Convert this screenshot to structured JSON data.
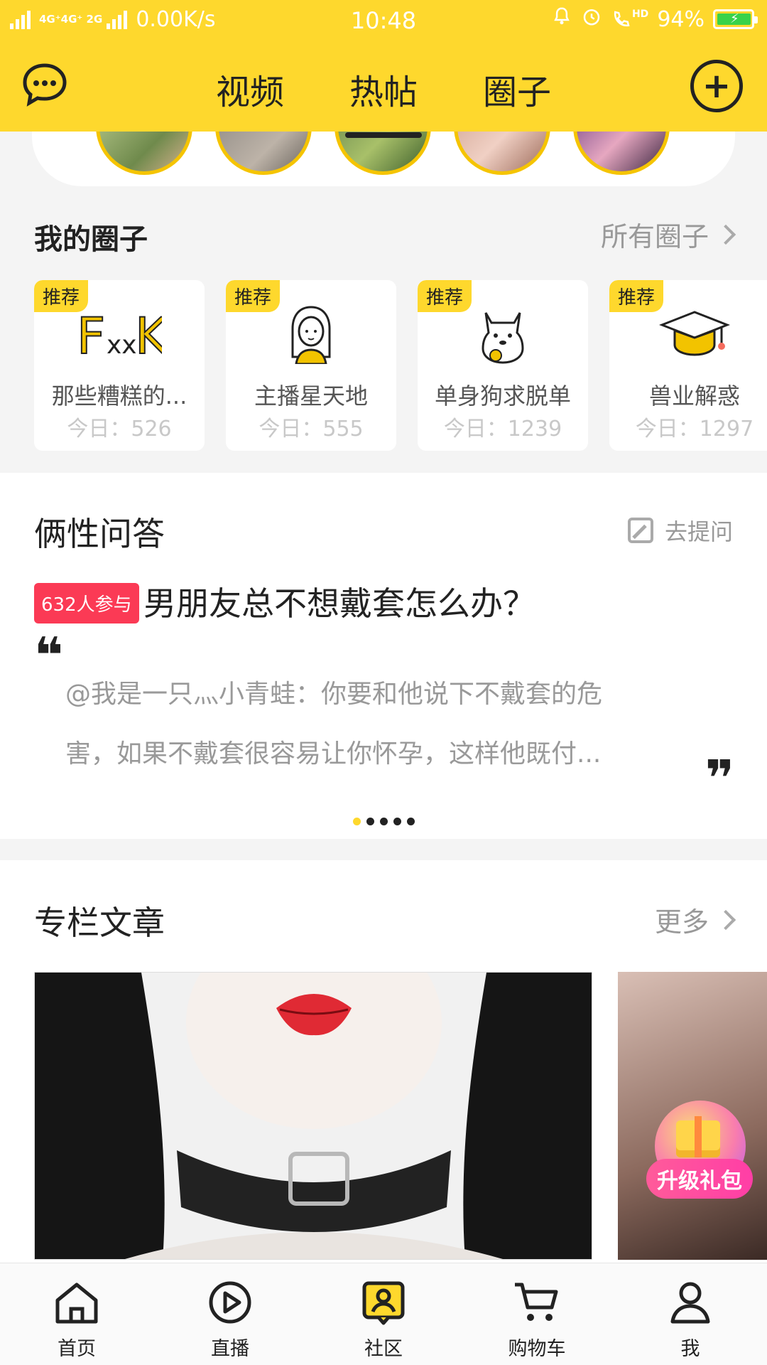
{
  "status_bar": {
    "network": "4G⁺4G⁺ 2G",
    "speed": "0.00K/s",
    "time": "10:48",
    "battery_text": "94%",
    "hd": "HD"
  },
  "header": {
    "tabs": [
      {
        "label": "视频"
      },
      {
        "label": "热帖"
      },
      {
        "label": "圈子"
      }
    ],
    "active_tab": "热帖",
    "plus_symbol": "+"
  },
  "my_circles": {
    "title": "我的圈子",
    "all_link": "所有圈子",
    "items": [
      {
        "badge": "推荐",
        "name": "那些糟糕的...",
        "count": "今日：526",
        "icon": "fxk-icon"
      },
      {
        "badge": "推荐",
        "name": "主播星天地",
        "count": "今日：555",
        "icon": "girl-icon"
      },
      {
        "badge": "推荐",
        "name": "单身狗求脱单",
        "count": "今日：1239",
        "icon": "dog-icon"
      },
      {
        "badge": "推荐",
        "name": "兽业解惑",
        "count": "今日：1297",
        "icon": "graduation-cap-icon"
      }
    ]
  },
  "qa": {
    "title": "俩性问答",
    "ask_label": "去提问",
    "badge": "632人参与",
    "question": "男朋友总不想戴套怎么办？",
    "answer_line1": "@我是一只灬小青蛙：你要和他说下不戴套的危",
    "answer_line2": "害，如果不戴套很容易让你怀孕，这样他既付...",
    "quote_open": "❝",
    "quote_close": "❞",
    "pager": {
      "count": 5,
      "active_index": 0
    }
  },
  "columns": {
    "title": "专栏文章",
    "more_label": "更多"
  },
  "gift": {
    "label": "升级礼包"
  },
  "bottom_nav": {
    "items": [
      {
        "label": "首页",
        "icon": "home-icon"
      },
      {
        "label": "直播",
        "icon": "play-icon"
      },
      {
        "label": "社区",
        "icon": "community-icon"
      },
      {
        "label": "购物车",
        "icon": "cart-icon"
      },
      {
        "label": "我",
        "icon": "user-icon"
      }
    ],
    "active": "社区"
  },
  "colors": {
    "brand_yellow": "#fed82d",
    "badge_red": "#fb3a55",
    "text_dark": "#222222",
    "text_muted": "#999999"
  }
}
